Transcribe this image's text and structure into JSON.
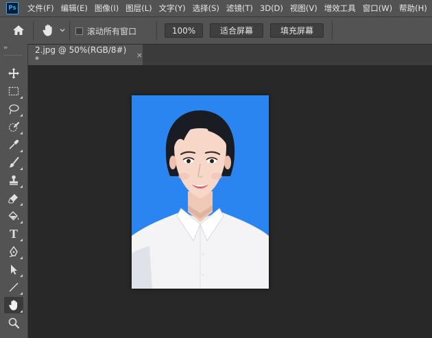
{
  "app": {
    "logo": "Ps"
  },
  "menu": [
    "文件(F)",
    "编辑(E)",
    "图像(I)",
    "图层(L)",
    "文字(Y)",
    "选择(S)",
    "滤镜(T)",
    "3D(D)",
    "视图(V)",
    "增效工具",
    "窗口(W)",
    "帮助(H)"
  ],
  "options": {
    "scroll_all_windows": "滚动所有窗口",
    "scroll_all_checked": false,
    "zoom": "100%",
    "fit_screen": "适合屏幕",
    "fill_screen": "填充屏幕"
  },
  "document": {
    "tab_title": "2.jpg @ 50%(RGB/8#) *",
    "close": "×"
  },
  "toolbar": {
    "collapse": "››",
    "tools": [
      "move-tool",
      "marquee-tool",
      "lasso-tool",
      "quick-selection-tool",
      "eyedropper-tool",
      "brush-tool",
      "clone-stamp-tool",
      "eraser-tool",
      "paint-bucket-tool",
      "type-tool",
      "pen-tool",
      "path-selection-tool",
      "line-tool",
      "hand-tool",
      "zoom-tool"
    ],
    "active_tool": "hand-tool",
    "type_glyph": "T"
  },
  "colors": {
    "photo_background": "#2a85f0",
    "ui_panel": "#535353",
    "canvas": "#282828"
  }
}
